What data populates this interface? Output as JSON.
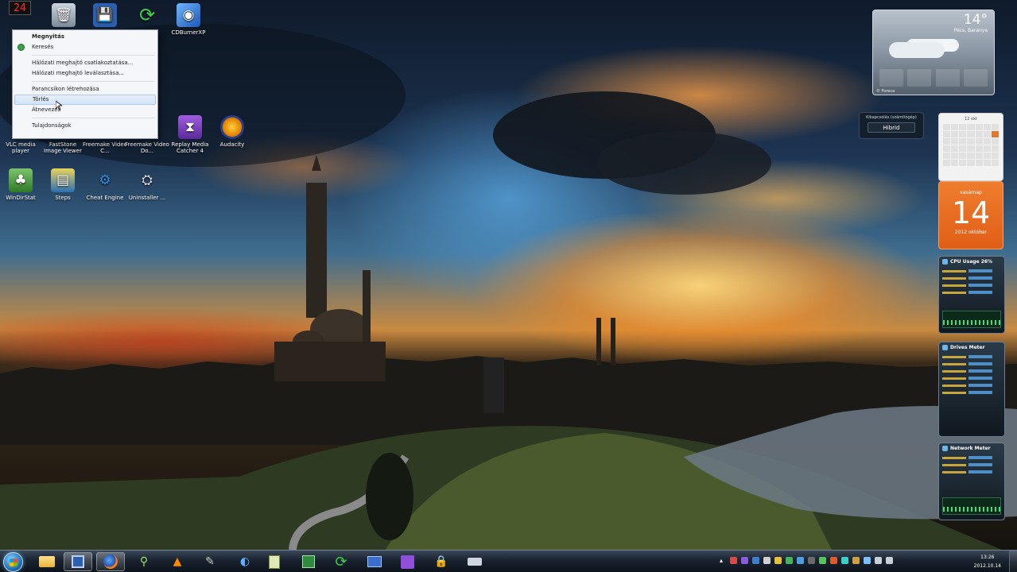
{
  "desktop": {
    "icons_row1": [
      {
        "label": "",
        "icon": "recycle-bin-icon"
      },
      {
        "label": "",
        "icon": "floppy-save-icon"
      },
      {
        "label": "",
        "icon": "refresh-arrows-icon"
      },
      {
        "label": "CDBurnerXP",
        "icon": "cdburnerxp-icon"
      }
    ],
    "top_left_counter": "24",
    "icons_row2": [
      {
        "label": "VLC media player",
        "icon": "vlc-icon"
      },
      {
        "label": "FastStone Image Viewer",
        "icon": "faststone-icon"
      },
      {
        "label": "Freemake Video C...",
        "icon": "freemake-icon"
      },
      {
        "label": "Freemake Video Do...",
        "icon": "freemake-downloader-icon"
      },
      {
        "label": "Replay Media Catcher 4",
        "icon": "replay-media-catcher-icon"
      },
      {
        "label": "Audacity",
        "icon": "audacity-icon"
      }
    ],
    "icons_row3": [
      {
        "label": "WinDirStat",
        "icon": "windirstat-icon"
      },
      {
        "label": "Steps",
        "icon": "steps-icon"
      },
      {
        "label": "Cheat Engine",
        "icon": "cheat-engine-icon"
      },
      {
        "label": "Uninstaller ...",
        "icon": "uninstaller-icon"
      }
    ]
  },
  "context_menu": {
    "items": [
      {
        "label": "Megnyitás",
        "bold": true
      },
      {
        "label": "Keresés"
      },
      {
        "label": "Hálózati meghajtó csatlakoztatása..."
      },
      {
        "label": "Hálózati meghajtó leválasztása..."
      },
      {
        "label": "Parancsikon létrehozása"
      },
      {
        "label": "Törlés",
        "highlighted": true
      },
      {
        "label": "Átnevezés"
      },
      {
        "label": "Tulajdonságok"
      }
    ]
  },
  "gadgets": {
    "weather": {
      "temp": "14°",
      "location_line1": "Pécs, Baranya",
      "footer": "© Foreca"
    },
    "shutdown": {
      "caption": "Kikapcsolás (számítógép)",
      "button": "Hibrid"
    },
    "calendar_month": {
      "header": "12 okt"
    },
    "calendar_day": {
      "weekday": "vasárnap",
      "day": "14",
      "month_year": "2012 október"
    },
    "cpu_meter": {
      "title": "CPU Usage 26%"
    },
    "drives_meter": {
      "title": "Drives Meter"
    },
    "network_meter": {
      "title": "Network Meter"
    }
  },
  "taskbar": {
    "clock_time": "13:26",
    "clock_date": "2012.10.14"
  },
  "colors": {
    "accent": "#e05e16",
    "taskbar": "#1a2330",
    "menu_highlight": "#d3e2f5"
  }
}
